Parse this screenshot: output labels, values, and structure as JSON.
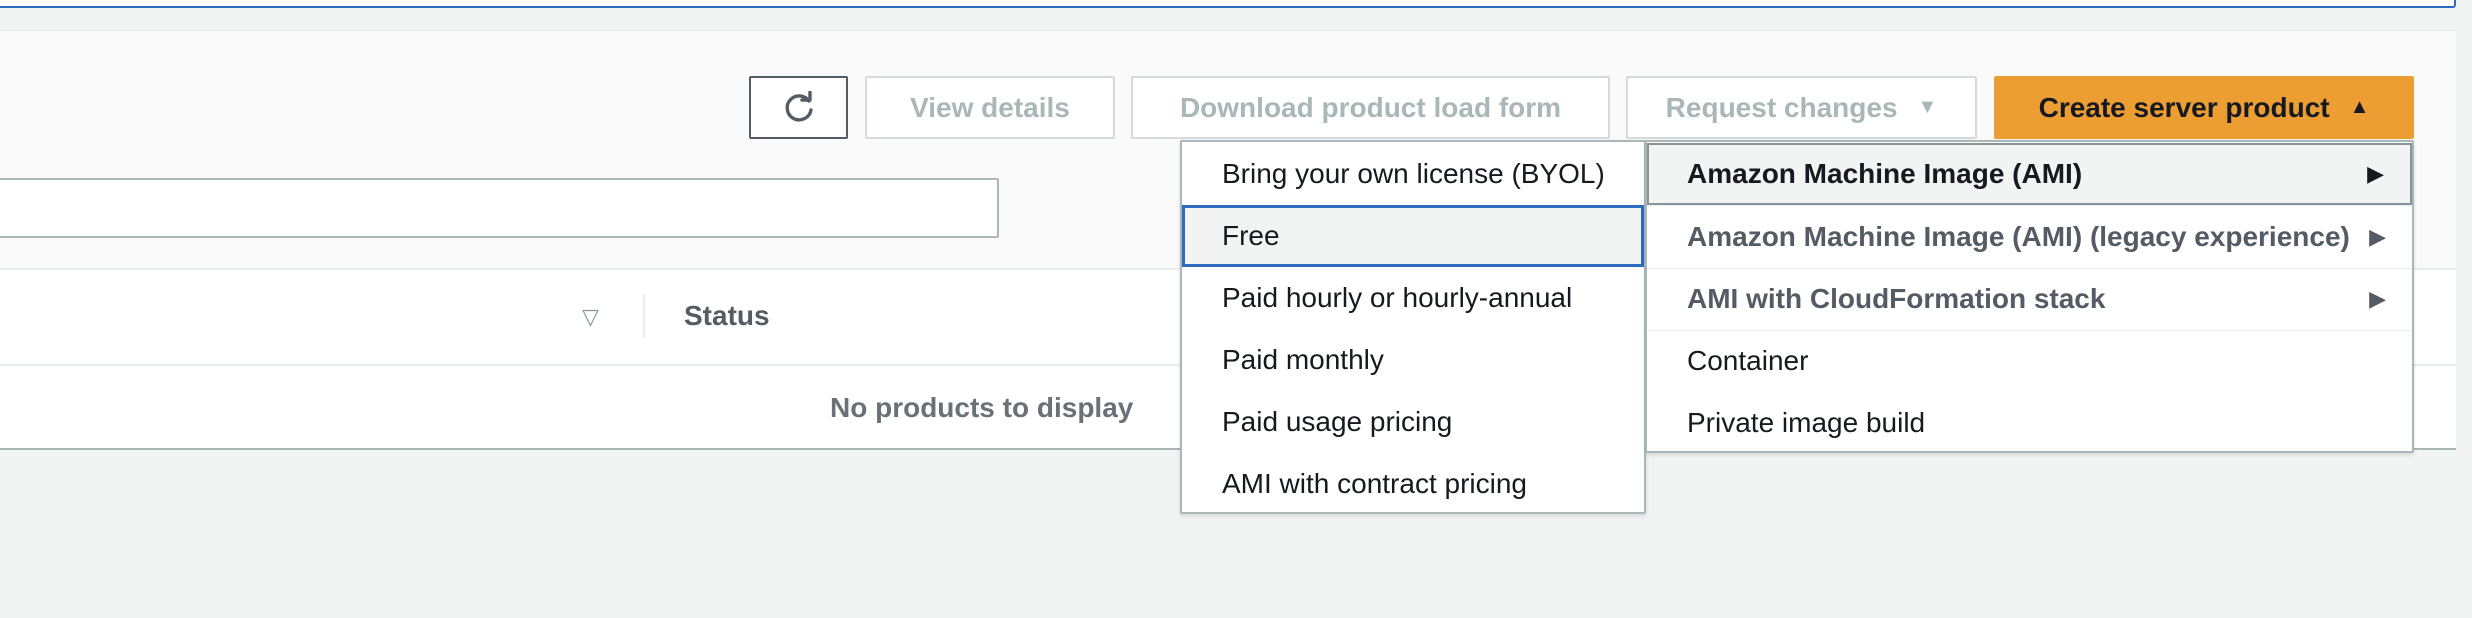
{
  "toolbar": {
    "refresh_icon": "refresh-icon",
    "view_details": "View details",
    "download_form": "Download product load form",
    "request_changes": "Request changes",
    "create_product": "Create server product"
  },
  "table": {
    "column_status": "Status",
    "empty_message": "No products to display"
  },
  "pricing_menu": {
    "items": [
      "Bring your own license (BYOL)",
      "Free",
      "Paid hourly or hourly-annual",
      "Paid monthly",
      "Paid usage pricing",
      "AMI with contract pricing"
    ],
    "focused": "Free"
  },
  "product_type_menu": {
    "items": [
      "Amazon Machine Image (AMI)",
      "Amazon Machine Image (AMI) (legacy experience)",
      "AMI with CloudFormation stack",
      "Container",
      "Private image build"
    ],
    "expanded": "Amazon Machine Image (AMI)"
  },
  "colors": {
    "primary": "#ec9e32",
    "focus": "#2d6bbf",
    "disabled_text": "#aab7b8"
  }
}
